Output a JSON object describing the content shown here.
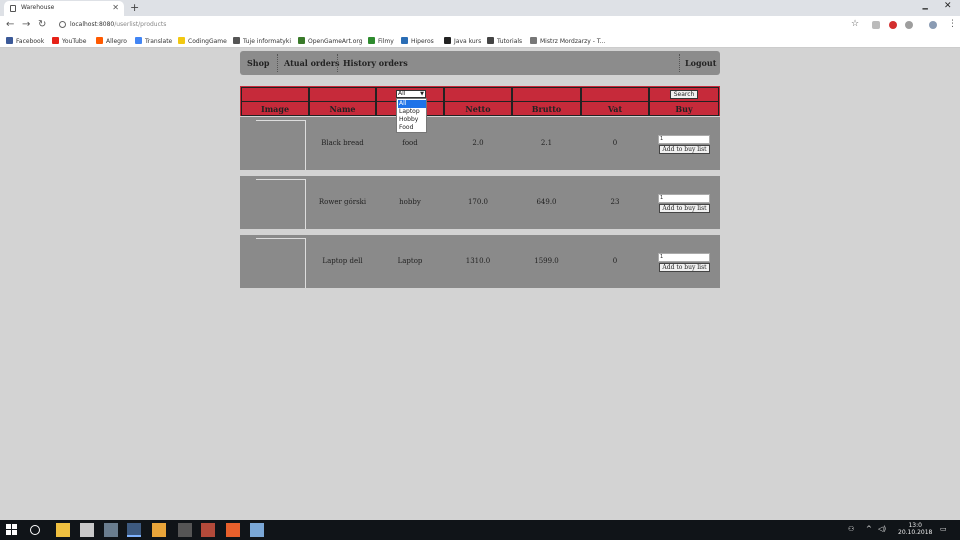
{
  "browser": {
    "tab_title": "Warehouse",
    "tab_close": "✕",
    "new_tab": "+",
    "url_host": "localhost:8080",
    "url_path": "/userlist/products",
    "back": "←",
    "forward": "→",
    "reload": "↻",
    "star": "☆",
    "menu": "⋮",
    "minimize": "🗕",
    "close": "✕"
  },
  "bookmarks": [
    {
      "label": "Facebook",
      "color": "#3b5998"
    },
    {
      "label": "YouTube",
      "color": "#e62117"
    },
    {
      "label": "Allegro",
      "color": "#ff5a00"
    },
    {
      "label": "Translate",
      "color": "#4285f4"
    },
    {
      "label": "CodingGame",
      "color": "#f2c811"
    },
    {
      "label": "Tuje informatyki",
      "color": "#555555"
    },
    {
      "label": "OpenGameArt.org",
      "color": "#3a7a2a"
    },
    {
      "label": "Filmy",
      "color": "#2e8b2e"
    },
    {
      "label": "Hiperos",
      "color": "#2a6db5"
    },
    {
      "label": "Java kurs",
      "color": "#222222"
    },
    {
      "label": "Tutorials",
      "color": "#444444"
    },
    {
      "label": "Mistrz Mordzarzy - T...",
      "color": "#777777"
    }
  ],
  "nav": {
    "shop": "Shop",
    "actual_orders": "Atual orders",
    "history_orders": "History orders",
    "logout": "Logout"
  },
  "filter": {
    "selected": "All",
    "options": [
      "All",
      "Laptop",
      "Hobby",
      "Food"
    ]
  },
  "search_label": "Search",
  "columns": {
    "image": "Image",
    "name": "Name",
    "netto": "Netto",
    "brutto": "Brutto",
    "vat": "Vat",
    "buy": "Buy"
  },
  "products": [
    {
      "name": "Black bread",
      "category": "food",
      "netto": "2.0",
      "brutto": "2.1",
      "vat": "0",
      "qty": "1",
      "button": "Add to buy list"
    },
    {
      "name": "Rower górski",
      "category": "hobby",
      "netto": "170.0",
      "brutto": "649.0",
      "vat": "23",
      "qty": "1",
      "button": "Add to buy list"
    },
    {
      "name": "Laptop dell",
      "category": "Laptop",
      "netto": "1310.0",
      "brutto": "1599.0",
      "vat": "0",
      "qty": "1",
      "button": "Add to buy list"
    }
  ],
  "taskbar": {
    "clock_time": "13:0",
    "clock_date": "20.10.2018"
  },
  "colors": {
    "header_red": "#c62a3a",
    "row_gray": "#8a8a8a",
    "page_bg": "#d3d3d3"
  }
}
